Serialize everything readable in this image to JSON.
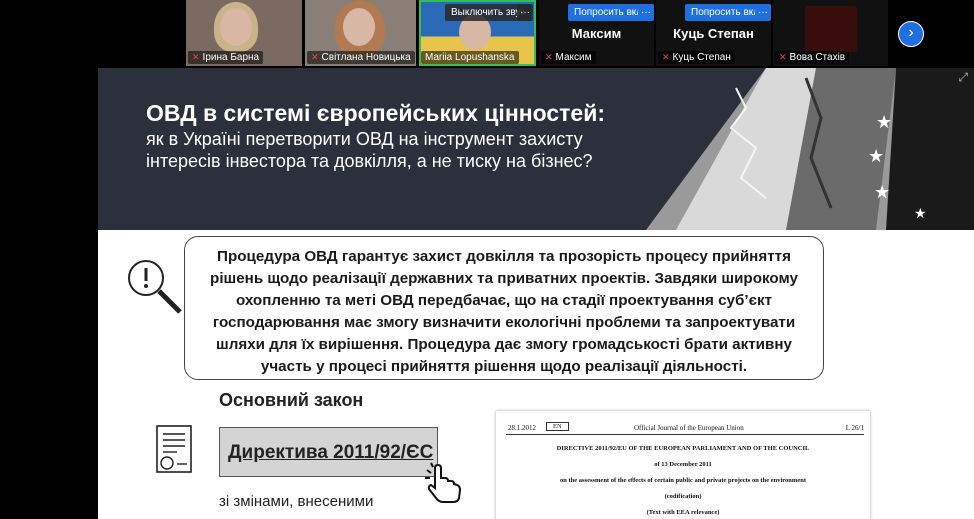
{
  "participants": [
    {
      "name": "Ірина Барна",
      "muted": true
    },
    {
      "name": "Світлана Новицька",
      "muted": true
    },
    {
      "name": "Mariia Lopushanska",
      "muted": false,
      "hover_label": "Выключить звук",
      "active": true
    },
    {
      "name": "Максим",
      "muted": true,
      "big_name": "Максим",
      "request_label": "Попросить вкл"
    },
    {
      "name": "Куць Степан",
      "muted": true,
      "big_name": "Куць Степан",
      "request_label": "Попросить вкл"
    },
    {
      "name": "Вова Стахів",
      "muted": true
    }
  ],
  "more_label": "···",
  "next_icon": "chevron-right-icon",
  "slide": {
    "title": "ОВД в системі європейських цінностей:",
    "subtitle": "як в Україні перетворити ОВД на інструмент захисту інтересів інвестора та довкілля, а не тиску на бізнес?",
    "callout_lines": [
      "Процедура ОВД гарантує захист довкілля та прозорість процесу прийняття",
      "рішень щодо реалізації державних та приватних проектів. Завдяки широкому",
      "охопленню та меті ОВД передбачає, що на стадії проектування суб’єкт",
      "господарювання має змогу визначити екологічні проблеми та запроектувати",
      "шляхи для їх вирішення. Процедура дає змогу громадськості брати активну",
      "участь у процесі прийняття рішення щодо реалізації діяльності."
    ],
    "law_heading": "Основний закон",
    "directive": "Директива 2011/92/ЄС",
    "amend_line1": "зі змінами, внесеними",
    "document": {
      "date": "28.1.2012",
      "lang": "EN",
      "journal": "Official Journal of the European Union",
      "page": "L 26/1",
      "lines": [
        "DIRECTIVE 2011/92/EU OF THE EUROPEAN PARLIAMENT AND OF THE COUNCIL",
        "of 13 December 2011",
        "on the assessment of the effects of certain public and private projects on the environment",
        "(codification)",
        "(Text with EEA relevance)"
      ]
    }
  },
  "colors": {
    "banner": "#2c2f3c",
    "accent_blue": "#3c8ad8",
    "zoom_blue": "#1f6fe0",
    "active_green": "#2fbf5a"
  }
}
